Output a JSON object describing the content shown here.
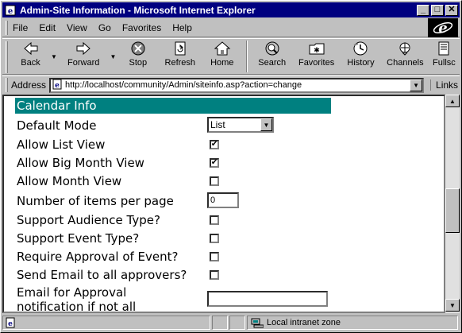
{
  "window": {
    "title": "Admin-Site Information - Microsoft Internet Explorer"
  },
  "menu": [
    "File",
    "Edit",
    "View",
    "Go",
    "Favorites",
    "Help"
  ],
  "toolbar": {
    "back": "Back",
    "forward": "Forward",
    "stop": "Stop",
    "refresh": "Refresh",
    "home": "Home",
    "search": "Search",
    "favorites": "Favorites",
    "history": "History",
    "channels": "Channels",
    "fullscreen": "Fullsc"
  },
  "address": {
    "label": "Address",
    "url": "http://localhost/community/Admin/siteinfo.asp?action=change",
    "links": "Links"
  },
  "form": {
    "section_title": "Calendar Info",
    "default_mode_label": "Default Mode",
    "default_mode_value": "List",
    "allow_list_label": "Allow List View",
    "allow_list_checked": "✔",
    "allow_big_month_label": "Allow Big Month View",
    "allow_big_month_checked": "✔",
    "allow_month_label": "Allow Month View",
    "items_per_page_label": "Number of items per page",
    "items_per_page_value": "0",
    "audience_label": "Support Audience Type?",
    "event_type_label": "Support Event Type?",
    "require_approval_label": "Require Approval of Event?",
    "send_email_label": "Send Email to all approvers?",
    "email_approval_label_1": "Email for Approval",
    "email_approval_label_2": "notification if not all",
    "email_approval_value": ""
  },
  "status": {
    "zone": "Local intranet zone"
  }
}
